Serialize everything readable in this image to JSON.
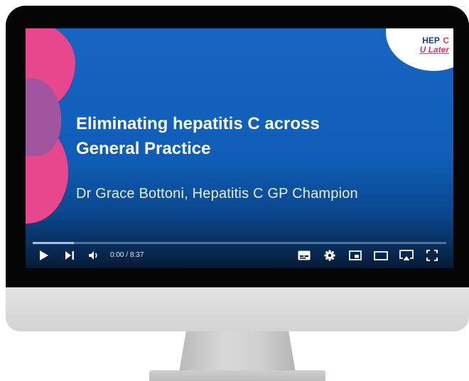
{
  "slide": {
    "title_line1": "Eliminating hepatitis C across",
    "title_line2": "General Practice",
    "subtitle": "Dr Grace Bottoni, Hepatitis C GP Champion"
  },
  "logo": {
    "line1": "HEP",
    "line1_accent": "C",
    "line2": "U Later"
  },
  "player": {
    "current_time": "0:00",
    "duration": "8:37",
    "time_separator": " / ",
    "progress_fraction": 0.0
  },
  "icons": {
    "play": "play-icon",
    "next": "next-icon",
    "volume": "volume-icon",
    "subtitles": "subtitles-icon",
    "settings": "settings-icon",
    "miniplayer": "miniplayer-icon",
    "theater": "theater-mode-icon",
    "cast": "cast-icon",
    "fullscreen": "fullscreen-icon"
  },
  "colors": {
    "slide_blue": "#1565c2",
    "brand_pink": "#e8478e",
    "brand_purple": "#a1559f",
    "progress_red": "#ff0000"
  }
}
